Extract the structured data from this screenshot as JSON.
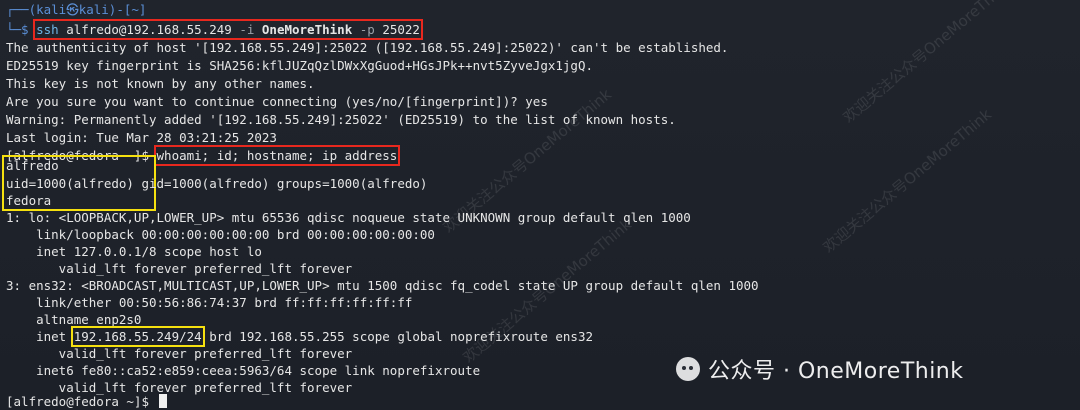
{
  "prompt": {
    "kali_top": "┌──(kali㉿kali)-[~]",
    "kali_prefix": "└─$ ",
    "ssh_cmd_a": "ssh ",
    "ssh_cmd_b": "alfredo@192.168.55.249",
    "ssh_cmd_c": " -i ",
    "ssh_cmd_d": "OneMoreThink",
    "ssh_cmd_e": " -p ",
    "ssh_cmd_f": "25022"
  },
  "output": {
    "l1": "The authenticity of host '[192.168.55.249]:25022 ([192.168.55.249]:25022)' can't be established.",
    "l2": "ED25519 key fingerprint is SHA256:kflJUZqQzlDWxXgGuod+HGsJPk++nvt5ZyveJgx1jgQ.",
    "l3": "This key is not known by any other names.",
    "l4": "Are you sure you want to continue connecting (yes/no/[fingerprint])? yes",
    "l5": "Warning: Permanently added '[192.168.55.249]:25022' (ED25519) to the list of known hosts.",
    "l6": "Last login: Tue Mar 28 03:21:25 2023",
    "fedora_prompt": "[alfredo@fedora ~]$ ",
    "cmd2": "whoami; id; hostname; ip address",
    "whoami": "alfredo",
    "id_uid": "uid=1000(alfredo)",
    "id_rest": " gid=1000(alfredo) groups=1000(alfredo)",
    "hostname": "fedora",
    "ip1": "1: lo: <LOOPBACK,UP,LOWER_UP> mtu 65536 qdisc noqueue state UNKNOWN group default qlen 1000",
    "ip2": "    link/loopback 00:00:00:00:00:00 brd 00:00:00:00:00:00",
    "ip3": "    inet 127.0.0.1/8 scope host lo",
    "ip4": "       valid_lft forever preferred_lft forever",
    "ip5": "3: ens32: <BROADCAST,MULTICAST,UP,LOWER_UP> mtu 1500 qdisc fq_codel state UP group default qlen 1000",
    "ip6": "    link/ether 00:50:56:86:74:37 brd ff:ff:ff:ff:ff:ff",
    "ip7": "    altname enp2s0",
    "ip8_a": "    inet ",
    "ip8_b": "192.168.55.249/24",
    "ip8_c": " brd 192.168.55.255 scope global noprefixroute ens32",
    "ip9": "       valid_lft forever preferred_lft forever",
    "ip10": "    inet6 fe80::ca52:e859:ceea:5963/64 scope link noprefixroute",
    "ip11": "       valid_lft forever preferred_lft forever",
    "final_prompt": "[alfredo@fedora ~]$ "
  },
  "watermark": {
    "tile_text": "欢迎关注公众号OneMoreThink",
    "brand_text": "公众号 · OneMoreThink"
  },
  "colors": {
    "background": "#1e222a",
    "prompt_blue": "#5b8fd6",
    "highlight_red": "#e8281e",
    "highlight_yellow": "#f5e00f"
  }
}
